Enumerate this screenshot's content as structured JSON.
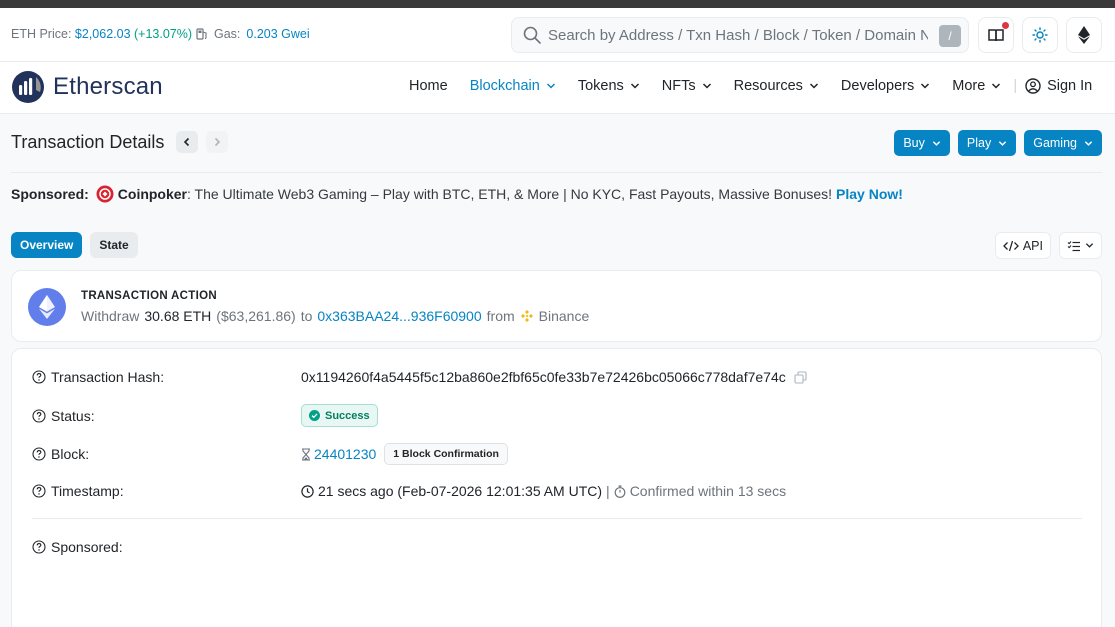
{
  "topbar": {
    "eth_price_label": "ETH Price:",
    "eth_price_value": "$2,062.03",
    "eth_price_change": "(+13.07%)",
    "gas_label": "Gas:",
    "gas_value": "0.203 Gwei",
    "search_placeholder": "Search by Address / Txn Hash / Block / Token / Domain Name",
    "search_shortcut": "/"
  },
  "brand": {
    "name": "Etherscan"
  },
  "nav": {
    "items": [
      {
        "label": "Home",
        "dropdown": false,
        "active": false
      },
      {
        "label": "Blockchain",
        "dropdown": true,
        "active": true
      },
      {
        "label": "Tokens",
        "dropdown": true,
        "active": false
      },
      {
        "label": "NFTs",
        "dropdown": true,
        "active": false
      },
      {
        "label": "Resources",
        "dropdown": true,
        "active": false
      },
      {
        "label": "Developers",
        "dropdown": true,
        "active": false
      },
      {
        "label": "More",
        "dropdown": true,
        "active": false
      }
    ],
    "separator": "|",
    "signin": "Sign In"
  },
  "page": {
    "title": "Transaction Details",
    "buttons": [
      "Buy",
      "Play",
      "Gaming"
    ]
  },
  "sponsored": {
    "label": "Sponsored:",
    "brand": "Coinpoker",
    "text": ": The Ultimate Web3 Gaming – Play with BTC, ETH, & More | No KYC, Fast Payouts, Massive Bonuses!",
    "cta": "Play Now!"
  },
  "tabs": {
    "overview": "Overview",
    "state": "State"
  },
  "tools": {
    "api": "API"
  },
  "action": {
    "title": "TRANSACTION ACTION",
    "verb": "Withdraw",
    "amount": "30.68 ETH",
    "usd": "($63,261.86)",
    "to": "to",
    "address": "0x363BAA24...936F60900",
    "from": "from",
    "exchange": "Binance"
  },
  "details": {
    "hash_label": "Transaction Hash:",
    "hash_value": "0x1194260f4a5445f5c12ba860e2fbf65c0fe33b7e72426bc05066c778daf7e74c",
    "status_label": "Status:",
    "status_value": "Success",
    "block_label": "Block:",
    "block_value": "24401230",
    "block_confirmations": "1 Block Confirmation",
    "timestamp_label": "Timestamp:",
    "timestamp_value": "21 secs ago (Feb-07-2026 12:01:35 AM UTC)",
    "timestamp_sep": "|",
    "confirmed": "Confirmed within 13 secs",
    "sponsored_label": "Sponsored:"
  },
  "colors": {
    "accent": "#0784c3",
    "success": "#00a186",
    "eth": "#627eea",
    "binance": "#f0b90b",
    "coinpoker": "#d9232e"
  }
}
